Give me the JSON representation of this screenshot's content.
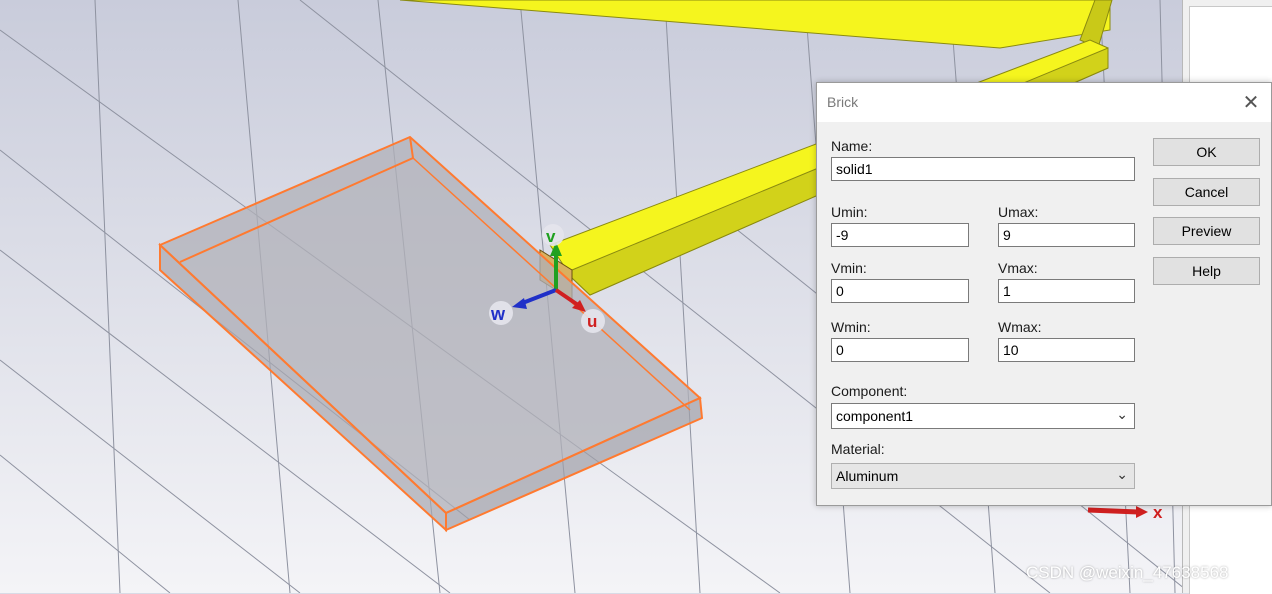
{
  "dialog": {
    "title": "Brick",
    "close_glyph": "✕",
    "name_label": "Name:",
    "name_value": "solid1",
    "umin_label": "Umin:",
    "umin_value": "-9",
    "umax_label": "Umax:",
    "umax_value": "9",
    "vmin_label": "Vmin:",
    "vmin_value": "0",
    "vmax_label": "Vmax:",
    "vmax_value": "1",
    "wmin_label": "Wmin:",
    "wmin_value": "0",
    "wmax_label": "Wmax:",
    "wmax_value": "10",
    "component_label": "Component:",
    "component_value": "component1",
    "material_label": "Material:",
    "material_value": "Aluminum",
    "buttons": {
      "ok": "OK",
      "cancel": "Cancel",
      "preview": "Preview",
      "help": "Help"
    }
  },
  "viewport": {
    "axis_labels": {
      "v": "v",
      "w": "w",
      "u": "u",
      "x": "x"
    },
    "colors": {
      "background": "#d8dbe6",
      "grid_line": "#8e92a0",
      "yellow_face": "#f5f51e",
      "yellow_side": "#d2d21a",
      "selection_outline": "#ff7a30",
      "axis_u": "#d02020",
      "axis_v": "#20a020",
      "axis_w": "#2030c8"
    }
  },
  "watermark": "CSDN @weixin_47638568"
}
